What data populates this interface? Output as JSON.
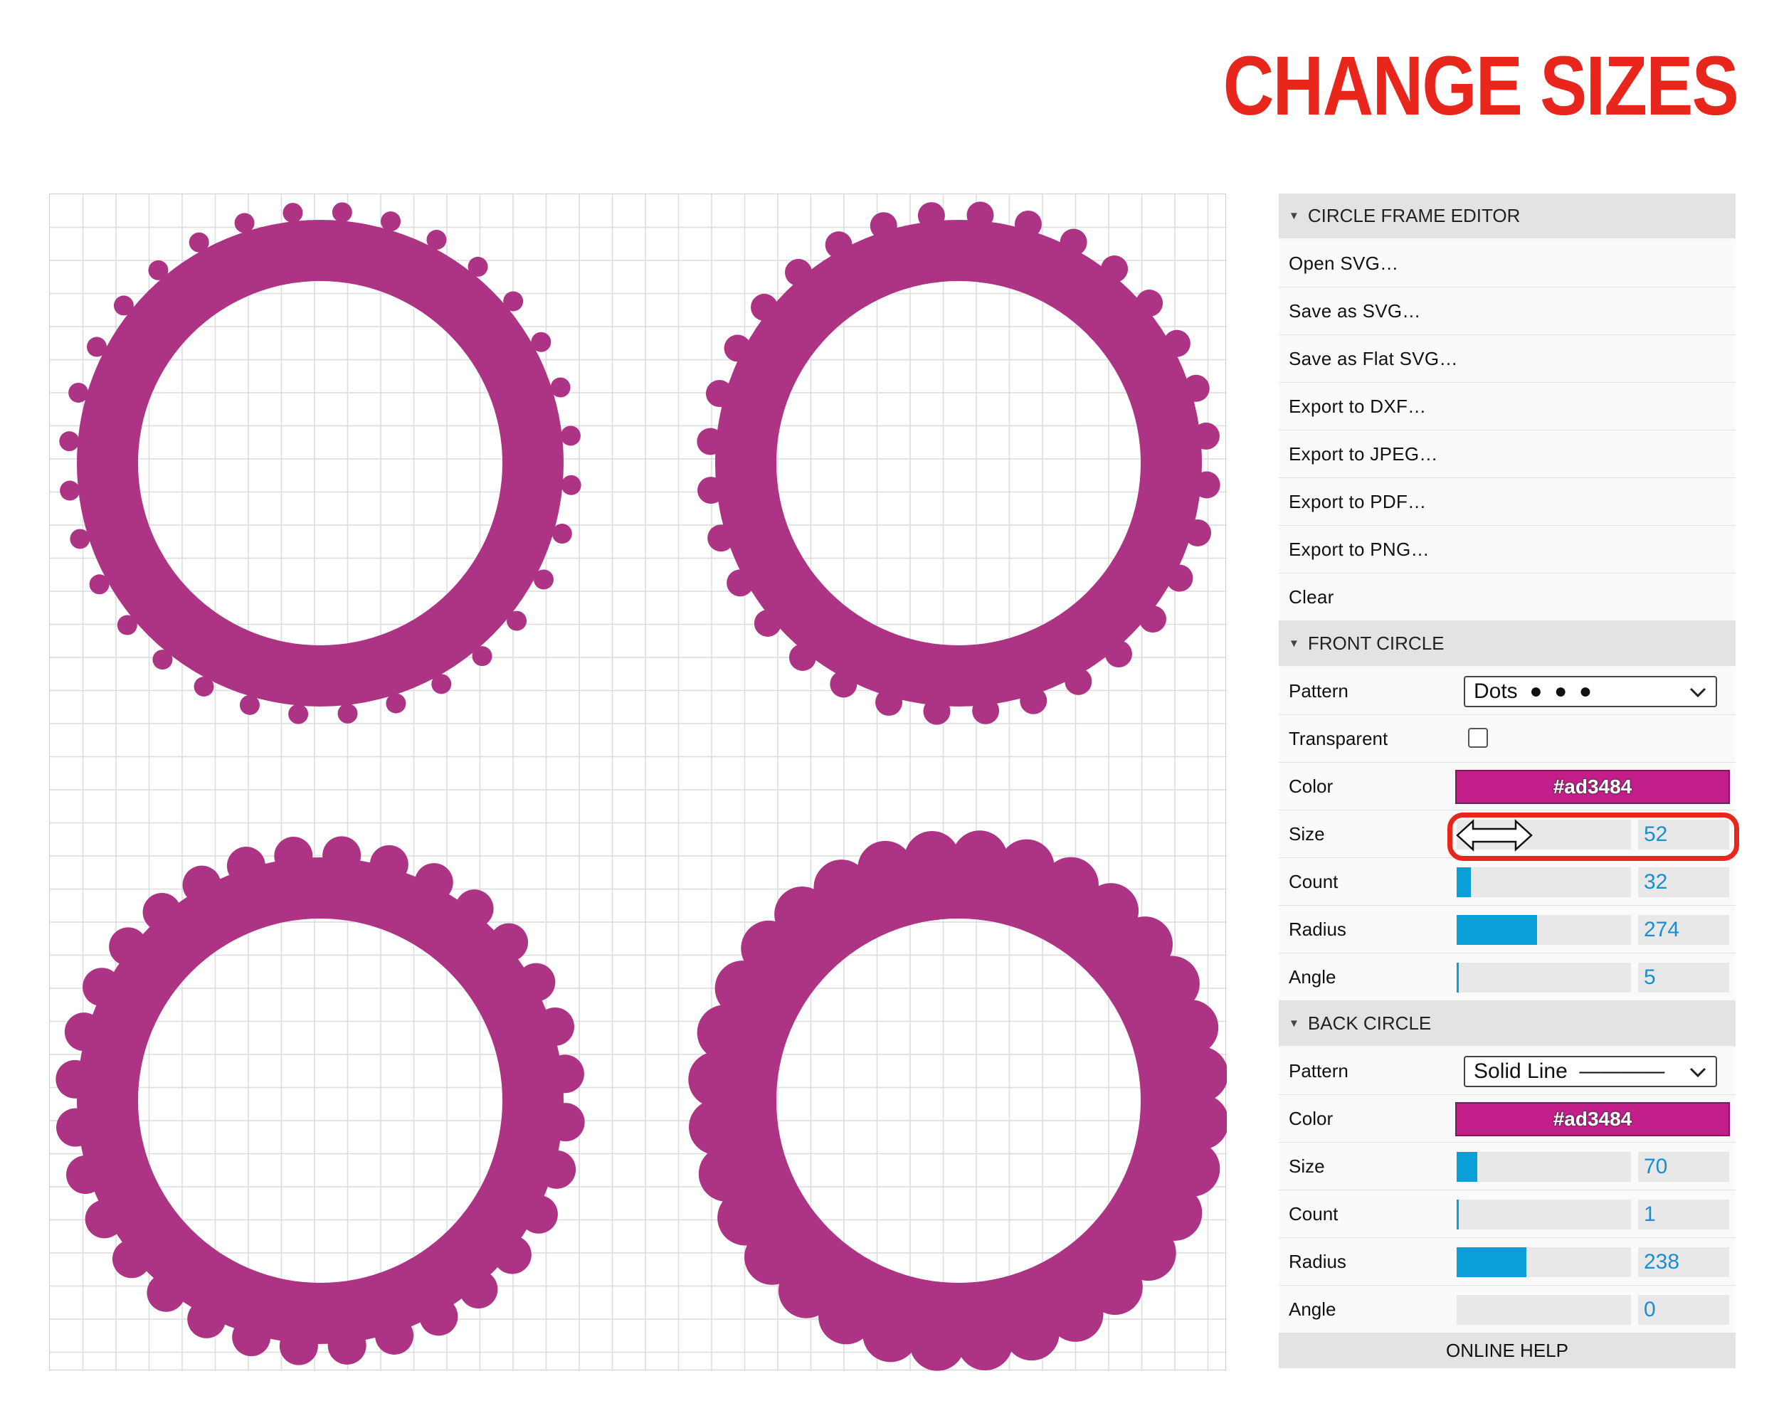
{
  "headline": "CHANGE SIZES",
  "editor": {
    "title": "CIRCLE FRAME EDITOR",
    "menu": [
      {
        "id": "open-svg",
        "label": "Open SVG…"
      },
      {
        "id": "save-svg",
        "label": "Save as SVG…"
      },
      {
        "id": "save-flat-svg",
        "label": "Save as Flat SVG…"
      },
      {
        "id": "export-dxf",
        "label": "Export to DXF…"
      },
      {
        "id": "export-jpeg",
        "label": "Export to JPEG…"
      },
      {
        "id": "export-pdf",
        "label": "Export to PDF…"
      },
      {
        "id": "export-png",
        "label": "Export to PNG…"
      },
      {
        "id": "clear",
        "label": "Clear"
      }
    ]
  },
  "front_circle": {
    "title": "FRONT CIRCLE",
    "pattern_label": "Pattern",
    "pattern_value": "Dots  ●  ●  ●",
    "transparent_label": "Transparent",
    "transparent_checked": false,
    "color_label": "Color",
    "color_value": "#ad3484",
    "size_label": "Size",
    "size_value": "52",
    "size_fill": 0.0,
    "count_label": "Count",
    "count_value": "32",
    "count_fill": 0.08,
    "radius_label": "Radius",
    "radius_value": "274",
    "radius_fill": 0.46,
    "angle_label": "Angle",
    "angle_value": "5",
    "angle_fill": 0.012
  },
  "back_circle": {
    "title": "BACK CIRCLE",
    "pattern_label": "Pattern",
    "pattern_value": "Solid Line  ————",
    "color_label": "Color",
    "color_value": "#ad3484",
    "size_label": "Size",
    "size_value": "70",
    "size_fill": 0.12,
    "count_label": "Count",
    "count_value": "1",
    "count_fill": 0.004,
    "radius_label": "Radius",
    "radius_value": "238",
    "radius_fill": 0.4,
    "angle_label": "Angle",
    "angle_value": "0",
    "angle_fill": 0.0
  },
  "online_help": "ONLINE HELP",
  "colors": {
    "frame": "#ad3484",
    "swatch": "#c21f8a",
    "slider_fill": "#0a9fd8",
    "value_text": "#1a8fd0",
    "highlight": "#e8261c",
    "grid": "#dcdcdc"
  },
  "icons": [
    "chevron-down-icon",
    "resize-horizontal-icon",
    "caret-down-icon"
  ]
}
